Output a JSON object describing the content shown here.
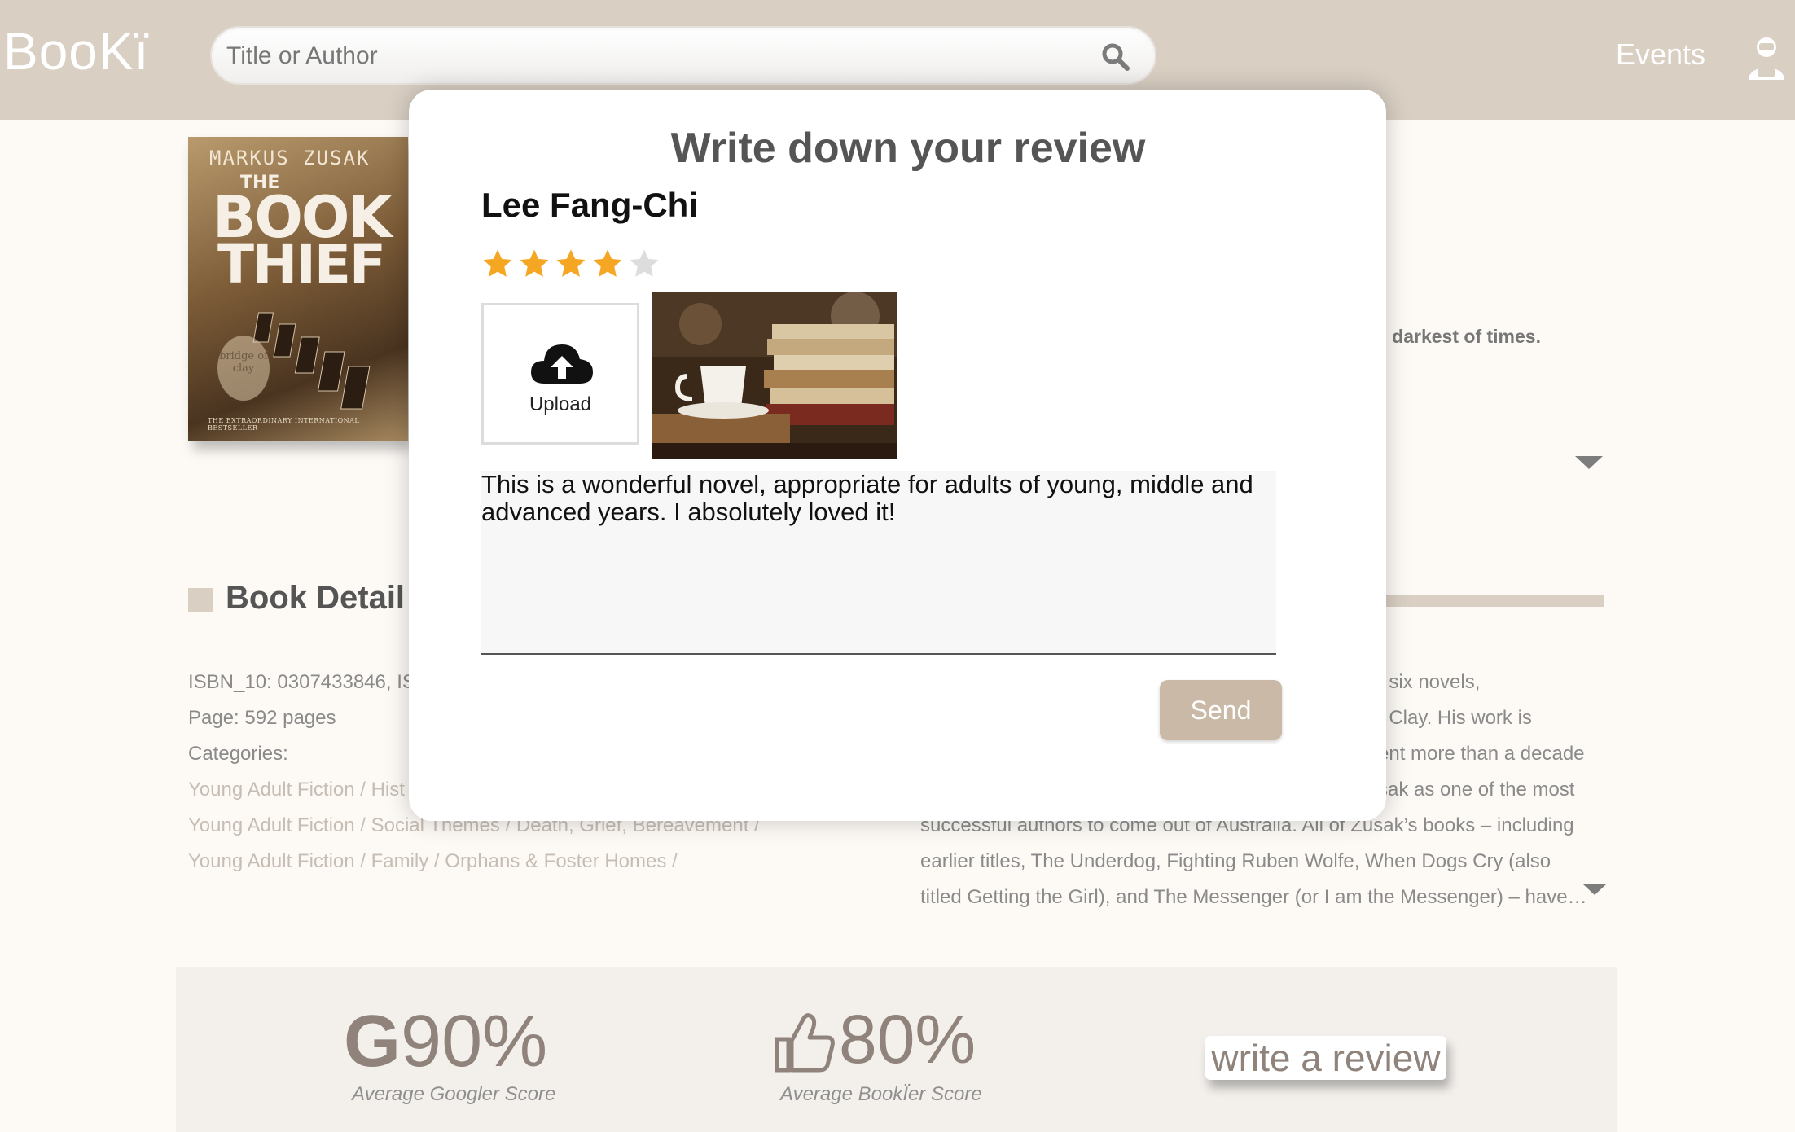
{
  "header": {
    "logo": "BooKï",
    "search_placeholder": "Title or Author",
    "nav_events": "Events"
  },
  "book": {
    "cover": {
      "author": "MARKUS ZUSAK",
      "the": "THE",
      "title_line1": "BOOK",
      "title_line2": "THIEF",
      "badge": "bridge of clay",
      "footer": "THE EXTRAORDINARY INTERNATIONAL BESTSELLER"
    },
    "tagline_fragment": "e darkest of times."
  },
  "details": {
    "section_title": "Book Detail",
    "isbn": "ISBN_10: 0307433846, IS",
    "pages": "Page: 592 pages",
    "categories_label": "Categories:",
    "categories": [
      "Young Adult Fiction / Hist",
      "Young Adult Fiction / Social Themes / Death, Grief, Bereavement /",
      "Young Adult Fiction / Family / Orphans & Foster Homes /"
    ]
  },
  "about": {
    "lines": [
      "f six novels,",
      "f Clay. His work is",
      "ent more than a decade",
      "sak as one of the most",
      "successful authors to come out of Australia. All of Zusak’s books – including",
      "earlier titles, The Underdog, Fighting Ruben Wolfe, When Dogs Cry (also",
      "titled Getting the Girl), and The Messenger (or I am the Messenger) – have…"
    ]
  },
  "scores": {
    "google_letter": "G",
    "google_value": "90%",
    "google_label": "Average Googler Score",
    "bookier_value": "80%",
    "bookier_label": "Average BookÏer Score",
    "write_review": "write a review"
  },
  "modal": {
    "title": "Write down your review",
    "user_name": "Lee Fang-Chi",
    "rating": 4,
    "rating_max": 5,
    "upload_label": "Upload",
    "review_text": "This is a wonderful novel, appropriate for adults of young, middle and advanced years. I absolutely loved it!",
    "send_label": "Send"
  },
  "colors": {
    "header_bg": "#d9cfc3",
    "star_on": "#f5a623",
    "star_off": "#dddddd",
    "send_bg": "#c9b9a6"
  }
}
